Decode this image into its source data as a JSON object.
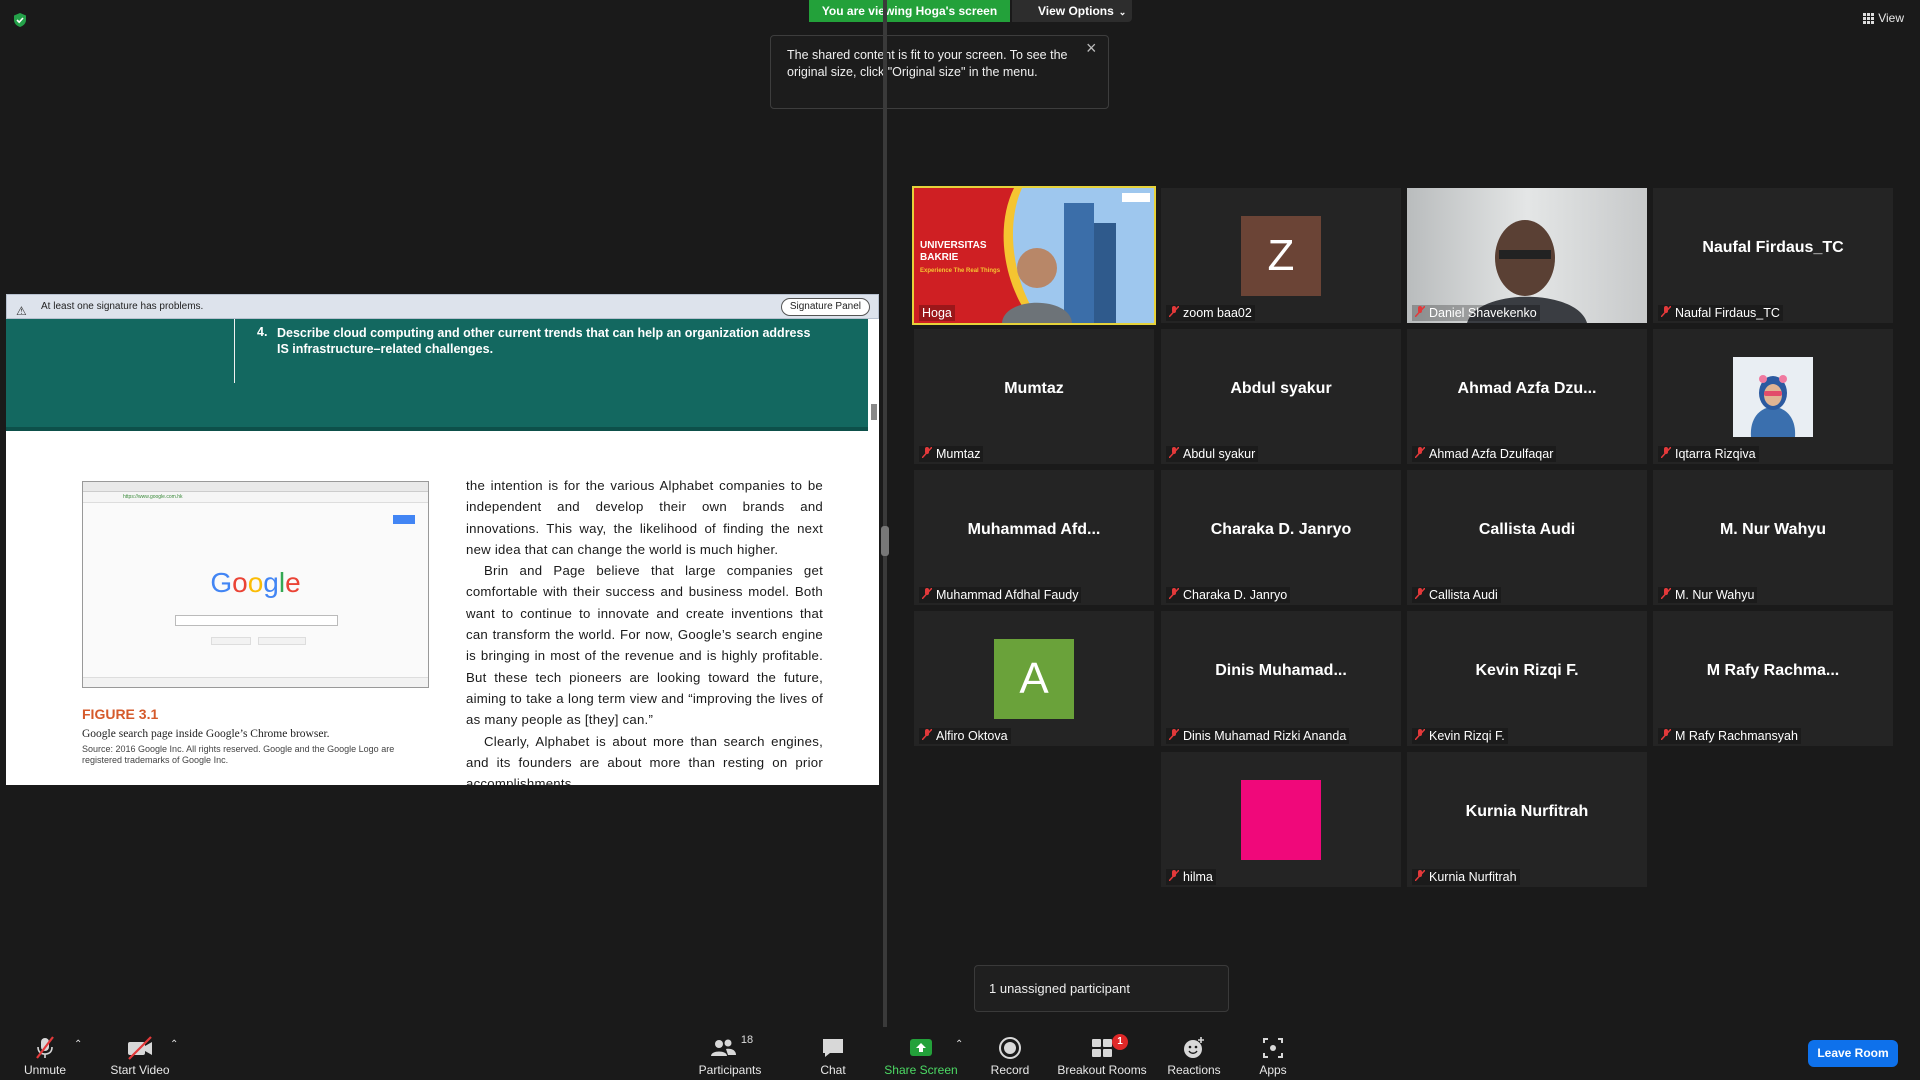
{
  "top": {
    "viewing_banner": "You are viewing Hoga's screen",
    "view_options": "View Options",
    "view_label": "View"
  },
  "tooltip": {
    "text": "The shared content is fit to your screen. To see the original size, click \"Original size\" in the menu."
  },
  "pdf": {
    "signature_warning": "At least one signature has problems.",
    "signature_panel": "Signature Panel",
    "objective_number": "4.",
    "objective_text": "Describe cloud computing and other current trends that can help an organization address IS infrastructure–related challenges.",
    "figure_title": "FIGURE 3.1",
    "figure_caption": "Google search page inside Google’s Chrome browser.",
    "figure_source": "Source: 2016 Google Inc. All rights reserved. Google and the Google Logo are registered trademarks of Google Inc.",
    "thumb_logo": "Google",
    "thumb_url": "https://www.google.com.hk",
    "paragraphs": [
      "the intention is for the various Alphabet companies to be independent and develop their own brands and innovations. This way, the likelihood of finding the next new idea that can change the world is much higher.",
      "Brin and Page believe that large companies get comfortable with their success and business model. Both want to continue to innovate and create inventions that can transform the world. For now, Google’s search engine is bringing in most of the revenue and is highly profitable. But these tech pioneers are looking toward the future, aiming to take a long term view and “improving the lives of as many people as [they] can.”",
      "Clearly, Alphabet is about more than search engines, and its founders are about more than resting on prior accomplishments."
    ]
  },
  "hoga_slide": {
    "line1": "UNIVERSITAS",
    "line2": "BAKRIE",
    "tagline": "Experience The Real Things"
  },
  "participants": [
    {
      "label": "Hoga",
      "display": "",
      "avatar_letter": "",
      "kind": "video-hoga",
      "active": true,
      "muted": false
    },
    {
      "label": "zoom baa02",
      "display": "",
      "avatar_letter": "Z",
      "avatar_color": "#6b4436",
      "kind": "avatar",
      "muted": true
    },
    {
      "label": "Daniel Shavekenko",
      "display": "",
      "avatar_letter": "",
      "kind": "video-daniel",
      "muted": true
    },
    {
      "label": "Naufal Firdaus_TC",
      "display": "Naufal Firdaus_TC",
      "kind": "name",
      "muted": true
    },
    {
      "label": "Mumtaz",
      "display": "Mumtaz",
      "kind": "name",
      "muted": true
    },
    {
      "label": "Abdul syakur",
      "display": "Abdul syakur",
      "kind": "name",
      "muted": true
    },
    {
      "label": "Ahmad Azfa Dzulfaqar",
      "display": "Ahmad  Azfa  Dzu...",
      "kind": "name",
      "muted": true
    },
    {
      "label": "Iqtarra Rizqiva",
      "display": "",
      "kind": "photo-iqtarra",
      "muted": true
    },
    {
      "label": "Muhammad Afdhal Faudy",
      "display": "Muhammad  Afd...",
      "kind": "name",
      "muted": true
    },
    {
      "label": "Charaka D. Janryo",
      "display": "Charaka D. Janryo",
      "kind": "name",
      "muted": true
    },
    {
      "label": "Callista Audi",
      "display": "Callista Audi",
      "kind": "name",
      "muted": true
    },
    {
      "label": "M. Nur Wahyu",
      "display": "M. Nur Wahyu",
      "kind": "name",
      "muted": true
    },
    {
      "label": "Alfiro Oktova",
      "display": "",
      "avatar_letter": "A",
      "avatar_color": "#6aa23a",
      "kind": "avatar",
      "muted": true
    },
    {
      "label": "Dinis Muhamad Rizki Ananda",
      "display": "Dinis  Muhamad...",
      "kind": "name",
      "muted": true
    },
    {
      "label": "Kevin Rizqi F.",
      "display": "Kevin Rizqi F.",
      "kind": "name",
      "muted": true
    },
    {
      "label": "M Rafy Rachmansyah",
      "display": "M  Rafy  Rachma...",
      "kind": "name",
      "muted": true
    },
    {
      "label": "hilma",
      "display": "",
      "avatar_letter": "",
      "avatar_color": "#f0087a",
      "kind": "avatar",
      "muted": true
    },
    {
      "label": "Kurnia Nurfitrah",
      "display": "Kurnia Nurfitrah",
      "kind": "name",
      "muted": true
    }
  ],
  "toast": {
    "unassigned": "1 unassigned participant"
  },
  "toolbar": {
    "unmute": "Unmute",
    "start_video": "Start Video",
    "participants": "Participants",
    "participants_count": "18",
    "chat": "Chat",
    "share_screen": "Share Screen",
    "record": "Record",
    "breakout_rooms": "Breakout Rooms",
    "breakout_badge": "1",
    "reactions": "Reactions",
    "apps": "Apps",
    "leave_room": "Leave Room"
  },
  "colors": {
    "banner_green": "#23a13a",
    "leave_blue": "#0e71eb",
    "active_outline": "#e6d23a",
    "muted_red": "#e3393a"
  }
}
